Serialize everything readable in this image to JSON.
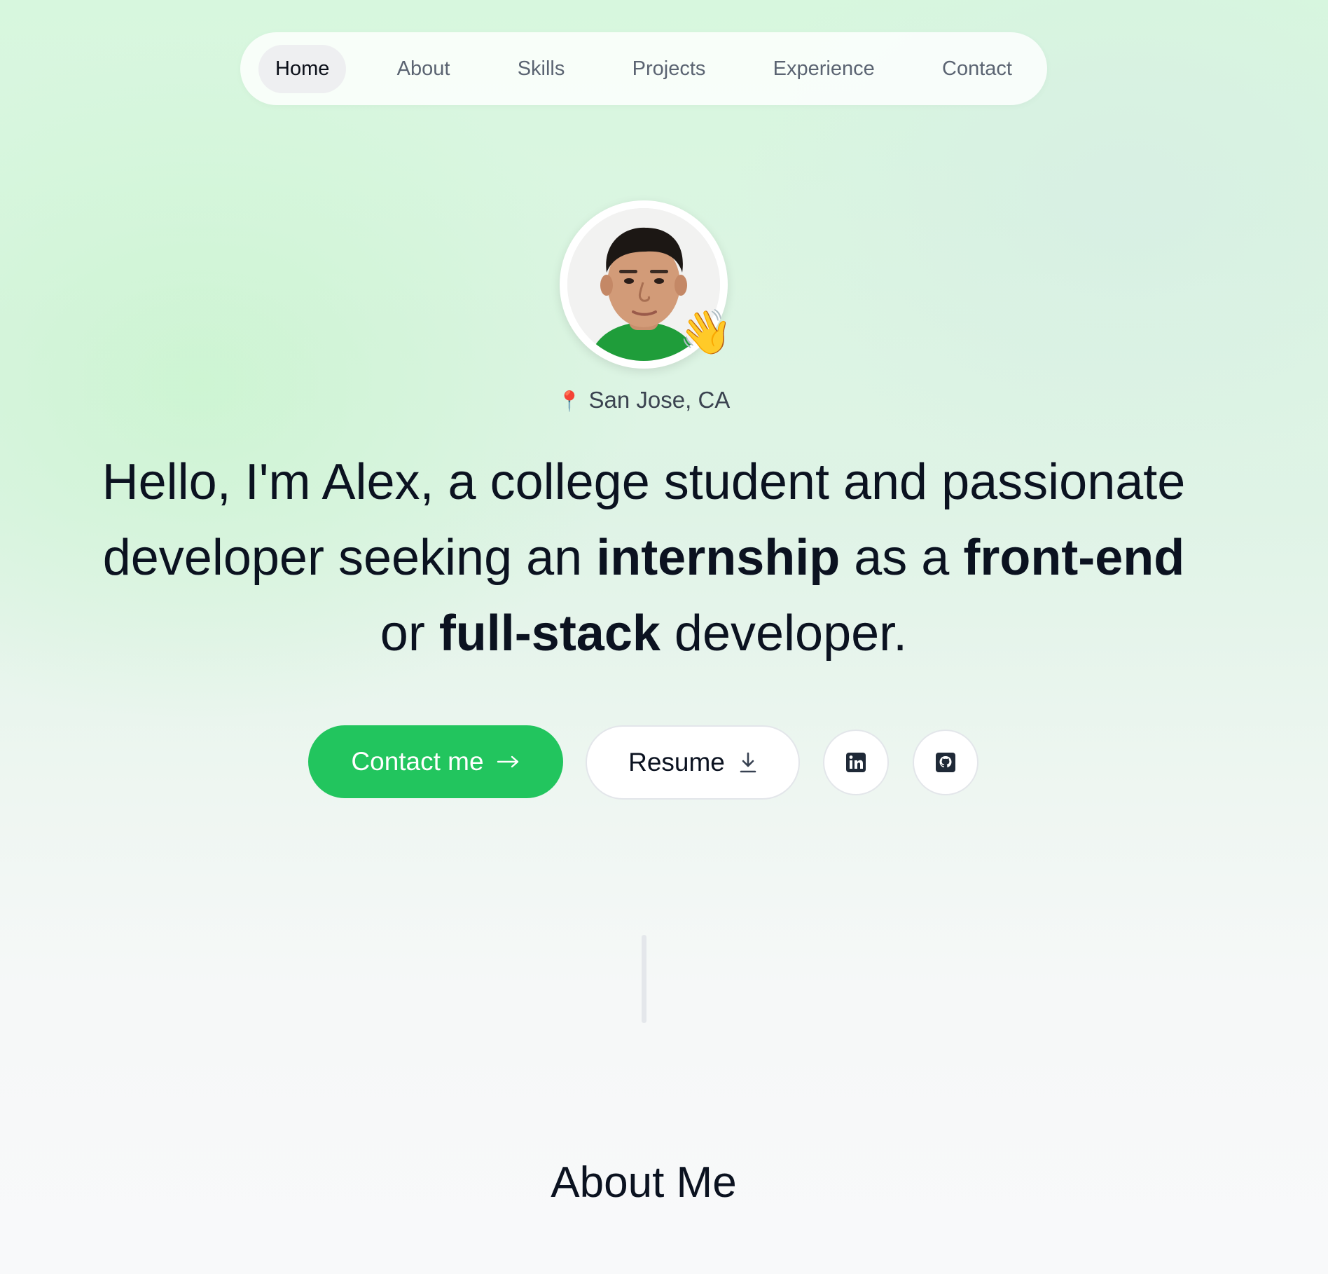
{
  "nav": {
    "items": [
      {
        "label": "Home",
        "active": true
      },
      {
        "label": "About",
        "active": false
      },
      {
        "label": "Skills",
        "active": false
      },
      {
        "label": "Projects",
        "active": false
      },
      {
        "label": "Experience",
        "active": false
      },
      {
        "label": "Contact",
        "active": false
      }
    ]
  },
  "hero": {
    "avatar_icon": "profile-photo",
    "wave_emoji": "👋",
    "location": {
      "icon": "📍",
      "text": "San Jose, CA"
    },
    "headline": {
      "part1": "Hello, I'm Alex, a college student and passionate developer seeking an ",
      "bold1": "internship",
      "part2": " as a ",
      "bold2": "front-end",
      "part3": " or ",
      "bold3": "full-stack",
      "part4": " developer."
    },
    "buttons": {
      "contact_label": "Contact me",
      "contact_icon": "arrow-right-icon",
      "resume_label": "Resume",
      "resume_icon": "download-icon",
      "linkedin_icon": "linkedin-icon",
      "github_icon": "github-icon"
    }
  },
  "about": {
    "title": "About Me"
  },
  "colors": {
    "accent": "#22c55e",
    "text": "#0b1220",
    "muted": "#5b6472"
  }
}
